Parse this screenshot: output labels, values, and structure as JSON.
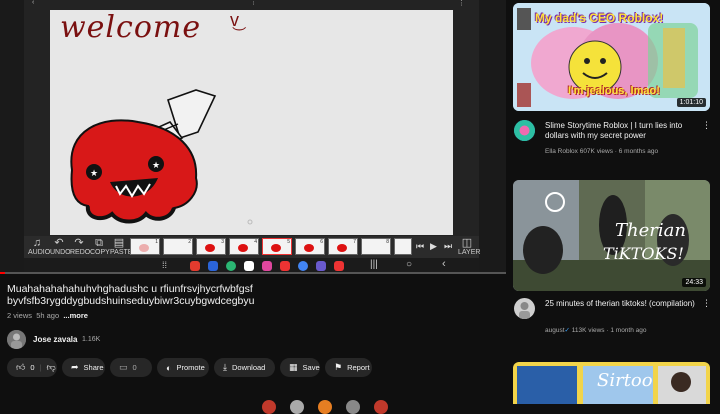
{
  "video": {
    "canvas_text": "welcome",
    "title": "Muahahahahahuhvhghadushc u rfiunfrsvjhycrfwbfgsf byvfsfb3rygddygbudshuinseduybiwr3cuybgwdcegbyu",
    "views": "2 views",
    "age": "5h ago",
    "more_label": "...more",
    "frames": [
      "1",
      "2",
      "3",
      "4",
      "5",
      "6",
      "7",
      "8"
    ],
    "toolbar": {
      "audio": "AUDIO",
      "undo": "UNDO",
      "redo": "REDO",
      "copy": "COPY",
      "paste": "PASTE",
      "layer": "LAYER"
    }
  },
  "channel": {
    "name": "Jose zavala",
    "subscribers": "1.16K"
  },
  "actions": {
    "likes": "0",
    "share": "Share",
    "save_count": "0",
    "promote": "Promote",
    "download": "Download",
    "save": "Save",
    "report": "Report"
  },
  "recommendations": [
    {
      "thumb_top_text": "My dad's CEO Roblox!",
      "thumb_bottom_text": "I'm jealous, lmao!",
      "duration": "1:01:10",
      "title": "Slime Storytime Roblox | I turn lies into dollars with my secret power",
      "channel": "Ella Roblox",
      "views": "607K views",
      "age": "6 months ago"
    },
    {
      "thumb_text_1": "Therian",
      "thumb_text_2": "TiKTOKS!",
      "duration": "24:33",
      "title": "25 minutes of therian tiktoks! (compilation)",
      "channel": "august",
      "views": "113K views",
      "age": "1 month ago"
    },
    {
      "thumb_text": "Sirtoo"
    }
  ],
  "colors": {
    "bg": "#0f0f0f",
    "pill": "#272727",
    "accent_red": "#d81818",
    "text_secondary": "#aaaaaa"
  }
}
